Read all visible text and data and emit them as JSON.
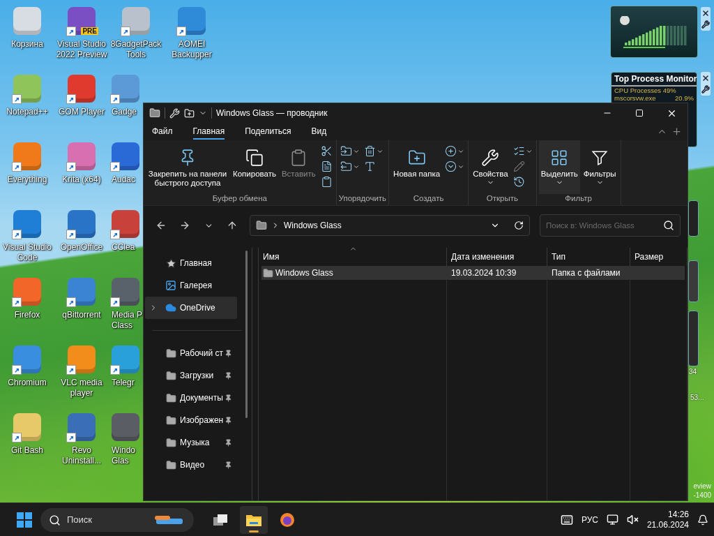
{
  "desktop_columns": [
    {
      "icons": [
        {
          "label": "Корзина",
          "shortcut": false,
          "color": "#d8dde3"
        },
        {
          "label": "Notepad++",
          "shortcut": true,
          "color": "#8fc45a"
        },
        {
          "label": "Everything",
          "shortcut": true,
          "color": "#f07a1a"
        },
        {
          "label": "Visual Studio Code",
          "shortcut": true,
          "color": "#1f7fd6"
        },
        {
          "label": "Firefox",
          "shortcut": true,
          "color": "#f2662a"
        },
        {
          "label": "Chromium",
          "shortcut": true,
          "color": "#3a8ee0"
        },
        {
          "label": "Git Bash",
          "shortcut": true,
          "color": "#e8c96a"
        }
      ]
    },
    {
      "icons": [
        {
          "label": "Visual Studio 2022 Preview",
          "shortcut": true,
          "color": "#7a4fc4",
          "badge": "PRE"
        },
        {
          "label": "GOM Player",
          "shortcut": true,
          "color": "#e03a2e"
        },
        {
          "label": "Krita (x64)",
          "shortcut": true,
          "color": "#d86fb0"
        },
        {
          "label": "OpenOffice",
          "shortcut": true,
          "color": "#2a74c8"
        },
        {
          "label": "qBittorrent",
          "shortcut": true,
          "color": "#3b84d4"
        },
        {
          "label": "VLC media player",
          "shortcut": true,
          "color": "#f28c1a"
        },
        {
          "label": "Revo Uninstall...",
          "shortcut": true,
          "color": "#3a6fb8"
        }
      ]
    },
    {
      "icons": [
        {
          "label": "8GadgetPack Tools",
          "shortcut": true,
          "color": "#b9c2cc"
        },
        {
          "label": "Gadge",
          "shortcut": true,
          "color": "#5b9ad6"
        },
        {
          "label": "Audac",
          "shortcut": true,
          "color": "#2a6ad6"
        },
        {
          "label": "CClea",
          "shortcut": true,
          "color": "#c8413a"
        },
        {
          "label": "Media P Class",
          "shortcut": true,
          "color": "#59616a"
        },
        {
          "label": "Telegr",
          "shortcut": true,
          "color": "#2aa0da"
        },
        {
          "label": "Windo Glas",
          "shortcut": false,
          "color": "#5a5e64"
        }
      ]
    },
    {
      "icons": [
        {
          "label": "AOMEI Backupper",
          "shortcut": true,
          "color": "#2f8ad8"
        }
      ]
    }
  ],
  "gadgets": {
    "monitor_title": "Top Process Monitor",
    "monitor_lines": [
      {
        "name": "CPU Processes 49%"
      },
      {
        "name": "mscorsvw.exe",
        "value": "20.9%"
      }
    ],
    "side_texts": [
      "34",
      "53..."
    ]
  },
  "desktop_build_text": [
    "eview",
    "-1400"
  ],
  "window": {
    "title": "Windows Glass — проводник",
    "menu_tabs": [
      {
        "label": "Файл",
        "selected": false
      },
      {
        "label": "Главная",
        "selected": true
      },
      {
        "label": "Поделиться",
        "selected": false
      },
      {
        "label": "Вид",
        "selected": false
      }
    ],
    "ribbon_groups": [
      {
        "label": "Буфер обмена",
        "items": [
          {
            "kind": "large",
            "label": "Закрепить на панели быстрого доступа",
            "disabled": false,
            "dropdown": false,
            "hovered": false
          },
          {
            "kind": "large",
            "label": "Копировать",
            "disabled": false,
            "dropdown": false,
            "hovered": false
          },
          {
            "kind": "large",
            "label": "Вставить",
            "disabled": true,
            "dropdown": false,
            "hovered": false
          },
          {
            "kind": "stack",
            "icons": [
              {
                "disabled": false,
                "dropdown": false
              },
              {
                "disabled": false,
                "dropdown": false
              },
              {
                "disabled": false,
                "dropdown": false
              }
            ]
          }
        ]
      },
      {
        "label": "Упорядочить",
        "items": [
          {
            "kind": "stack",
            "icons": [
              {
                "disabled": false,
                "dropdown": true
              },
              {
                "disabled": false,
                "dropdown": true
              }
            ]
          },
          {
            "kind": "stack",
            "icons": [
              {
                "disabled": false,
                "dropdown": true
              },
              {
                "disabled": false,
                "dropdown": false
              }
            ]
          }
        ]
      },
      {
        "label": "Создать",
        "items": [
          {
            "kind": "large",
            "label": "Новая папка",
            "disabled": false,
            "dropdown": false,
            "hovered": false
          },
          {
            "kind": "stack",
            "icons": [
              {
                "disabled": false,
                "dropdown": true
              },
              {
                "disabled": false,
                "dropdown": true
              }
            ]
          }
        ]
      },
      {
        "label": "Открыть",
        "items": [
          {
            "kind": "large",
            "label": "Свойства",
            "disabled": false,
            "dropdown": true,
            "hovered": false
          },
          {
            "kind": "stack",
            "icons": [
              {
                "disabled": false,
                "dropdown": true
              },
              {
                "disabled": true,
                "dropdown": false
              },
              {
                "disabled": false,
                "dropdown": false
              }
            ]
          }
        ]
      },
      {
        "label": "Фильтр",
        "items": [
          {
            "kind": "large",
            "label": "Выделить",
            "disabled": false,
            "dropdown": true,
            "hovered": true
          },
          {
            "kind": "large",
            "label": "Фильтры",
            "disabled": false,
            "dropdown": true,
            "hovered": false
          }
        ]
      }
    ],
    "address": {
      "path": "Windows Glass",
      "search_placeholder": "Поиск в: Windows Glass"
    },
    "nav_items": [
      {
        "label": "Главная",
        "expandable": false,
        "selected": false
      },
      {
        "label": "Галерея",
        "expandable": false,
        "selected": false
      },
      {
        "label": "OneDrive",
        "expandable": true,
        "selected": true
      }
    ],
    "pinned_items": [
      {
        "label": "Рабочий ст",
        "pinned": true
      },
      {
        "label": "Загрузки",
        "pinned": true
      },
      {
        "label": "Документы",
        "pinned": true
      },
      {
        "label": "Изображен",
        "pinned": true
      },
      {
        "label": "Музыка",
        "pinned": true
      },
      {
        "label": "Видео",
        "pinned": true
      }
    ],
    "columns": [
      "Имя",
      "Дата изменения",
      "Тип",
      "Размер"
    ],
    "rows": [
      {
        "name": "Windows Glass",
        "date": "19.03.2024 10:39",
        "type": "Папка с файлами",
        "selected": true
      }
    ]
  },
  "taskbar": {
    "search_placeholder": "Поиск",
    "apps": [
      {
        "kind": "taskview",
        "active": false
      },
      {
        "kind": "explorer",
        "active": true
      },
      {
        "kind": "firefox",
        "active": false
      }
    ],
    "language": "РУС",
    "time": "14:26",
    "date": "21.06.2024"
  }
}
